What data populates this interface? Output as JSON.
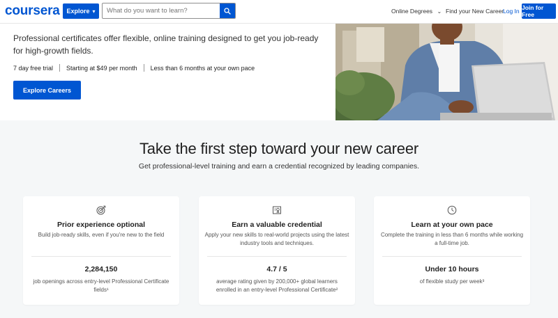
{
  "header": {
    "logo": "coursera",
    "explore_label": "Explore",
    "search_placeholder": "What do you want to learn?",
    "nav": {
      "online_degrees": "Online Degrees",
      "find_career": "Find your New Career",
      "login": "Log In",
      "join": "Join for Free"
    }
  },
  "hero": {
    "subtitle": "Professional certificates offer flexible, online training designed to get you job-ready for high-growth fields.",
    "features": [
      "7 day free trial",
      "Starting at $49 per month",
      "Less than 6 months at your own pace"
    ],
    "cta": "Explore Careers"
  },
  "main": {
    "title": "Take the first step toward your new career",
    "subtitle": "Get professional-level training and earn a credential recognized by leading companies.",
    "cards": [
      {
        "icon": "target-icon",
        "title": "Prior experience optional",
        "desc": "Build job-ready skills, even if you're new to the field",
        "stat": "2,284,150",
        "stat_desc": "job openings across entry-level Professional Certificate fields¹"
      },
      {
        "icon": "certificate-icon",
        "title": "Earn a valuable credential",
        "desc": "Apply your new skills to real-world projects using the latest industry tools and techniques.",
        "stat": "4.7 / 5",
        "stat_desc": "average rating given by 200,000+ global learners enrolled in an entry-level Professional Certificate²"
      },
      {
        "icon": "clock-icon",
        "title": "Learn at your own pace",
        "desc": "Complete the training in less than 6 months while working a full-time job.",
        "stat": "Under 10 hours",
        "stat_desc": "of flexible study per week³"
      }
    ]
  },
  "colors": {
    "brand": "#0056d2",
    "background": "#f5f7f8"
  }
}
